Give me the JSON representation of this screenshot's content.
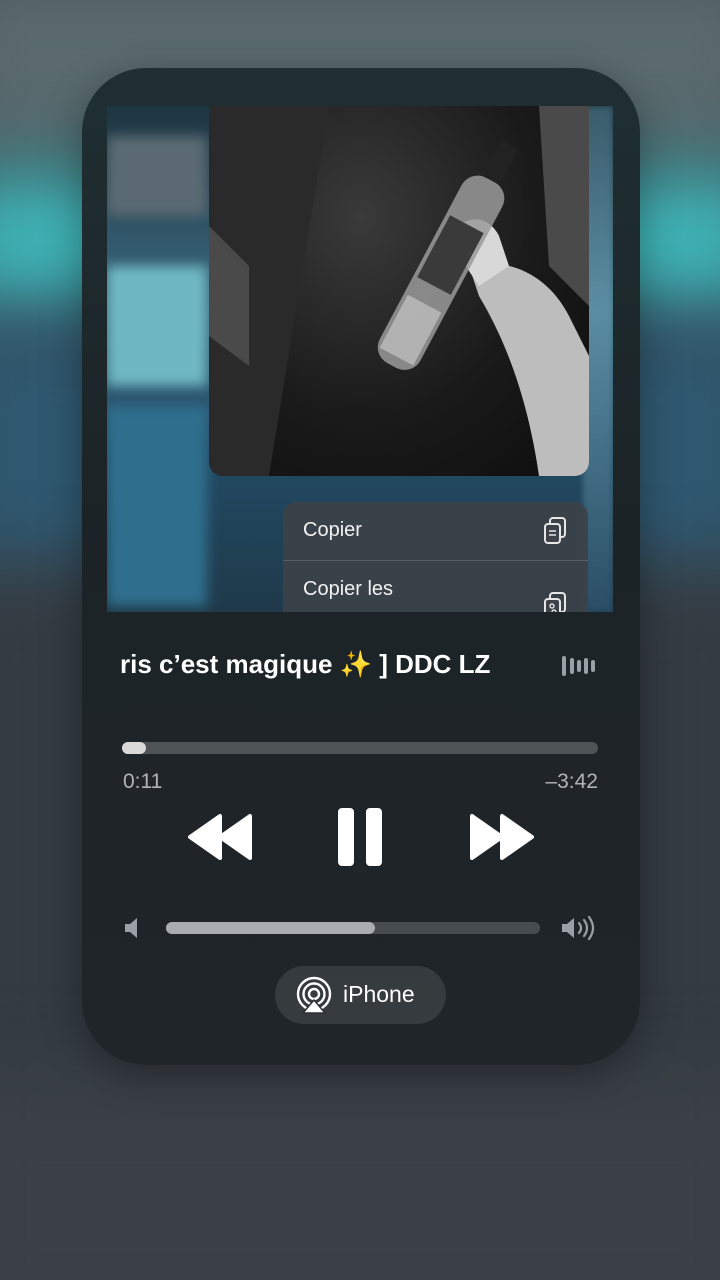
{
  "context_menu": {
    "items": [
      {
        "label": "Copier",
        "icon": "doc-on-doc-icon"
      },
      {
        "label": "Copier les",
        "icon": "copy-edits-icon"
      }
    ]
  },
  "now_playing": {
    "title": "ris c’est magique ✨ ] DDC LZ",
    "elapsed": "0:11",
    "remaining": "–3:42",
    "progress": 0.05,
    "volume": 0.56,
    "is_playing": true
  },
  "output": {
    "label": "iPhone",
    "icon": "airplay-icon"
  }
}
